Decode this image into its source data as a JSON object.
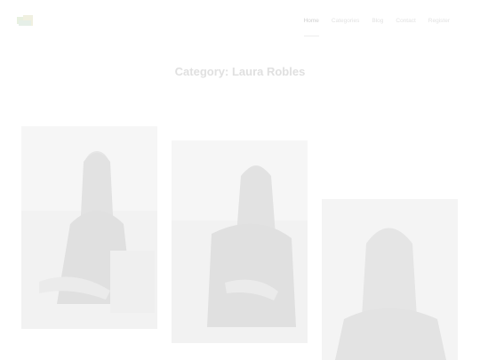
{
  "site": {
    "logo_alt": "Laura Robles logo"
  },
  "nav": {
    "items": [
      {
        "label": "Home",
        "active": true
      },
      {
        "label": "Categories",
        "active": false
      },
      {
        "label": "Blog",
        "active": false
      },
      {
        "label": "Contact",
        "active": false
      },
      {
        "label": "Register",
        "active": false
      }
    ]
  },
  "page": {
    "title": "Category: Laura Robles"
  },
  "colors": {
    "title": "#e0e0e0",
    "nav": "#e2e2e2",
    "card_bg": "#f3f3f3"
  }
}
